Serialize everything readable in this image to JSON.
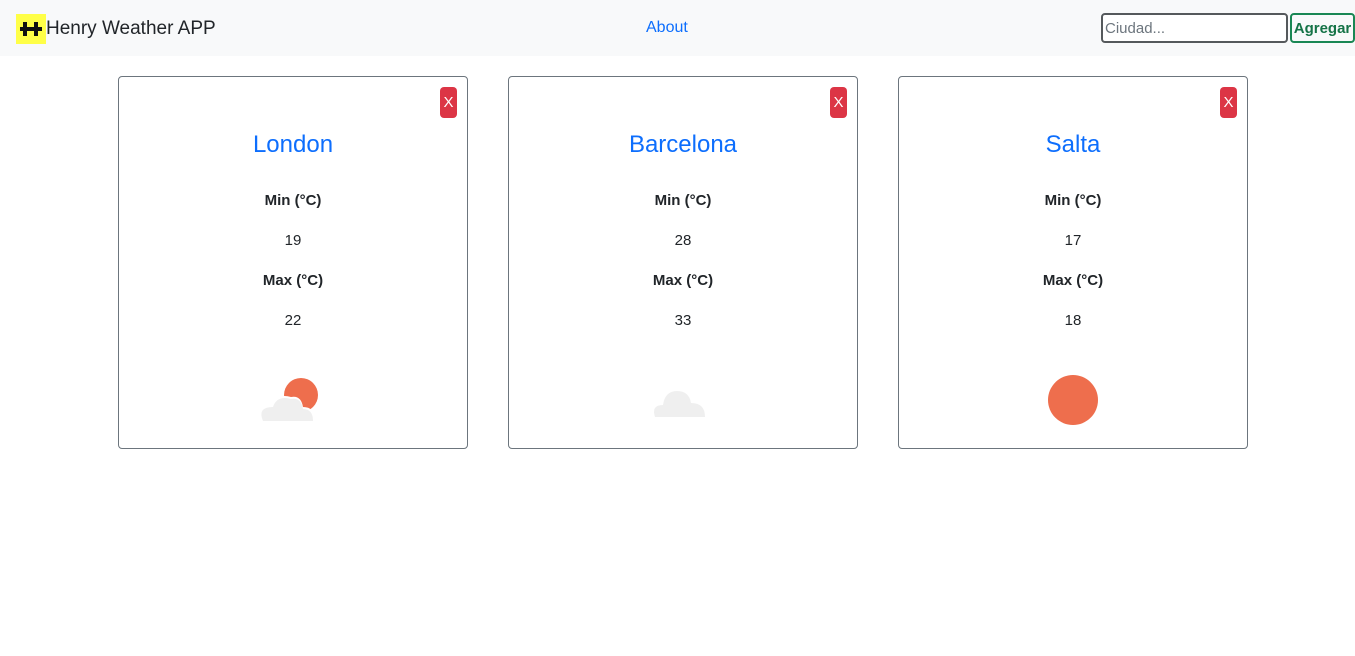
{
  "app": {
    "title": "Henry Weather APP",
    "accent_color": "#0d6efd",
    "logo_icon": "henry-logo-icon"
  },
  "nav": {
    "about_label": "About"
  },
  "search": {
    "placeholder": "Ciudad...",
    "value": "",
    "add_label": "Agregar"
  },
  "cards": [
    {
      "city": "London",
      "close_label": "X",
      "min_label": "Min (°C)",
      "min_value": "19",
      "max_label": "Max (°C)",
      "max_value": "22",
      "weather_icon": "partly-cloudy-icon"
    },
    {
      "city": "Barcelona",
      "close_label": "X",
      "min_label": "Min (°C)",
      "min_value": "28",
      "max_label": "Max (°C)",
      "max_value": "33",
      "weather_icon": "cloud-icon"
    },
    {
      "city": "Salta",
      "close_label": "X",
      "min_label": "Min (°C)",
      "min_value": "17",
      "max_label": "Max (°C)",
      "max_value": "18",
      "weather_icon": "sun-icon"
    }
  ]
}
